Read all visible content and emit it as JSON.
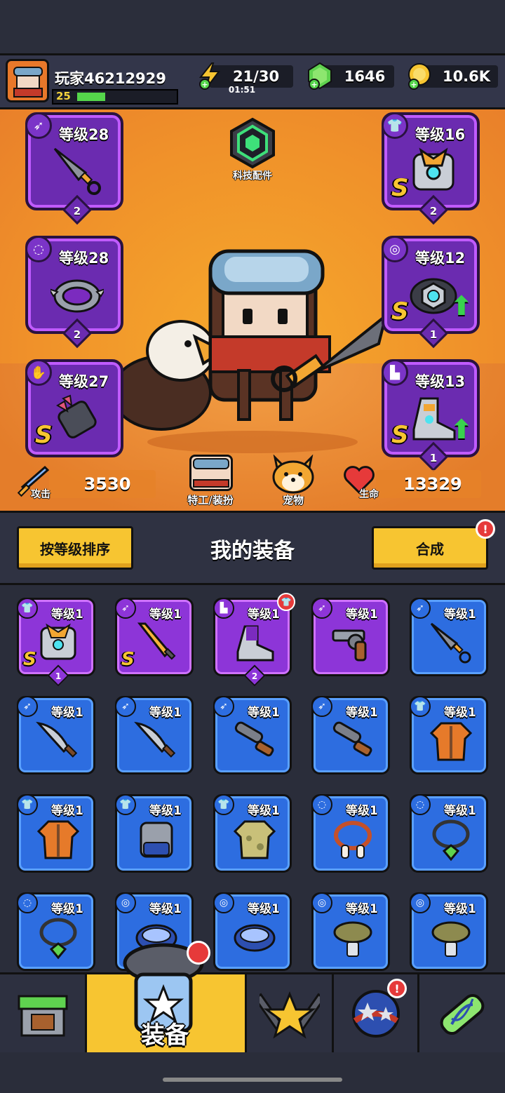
{
  "player": {
    "name": "玩家46212929",
    "level": "25"
  },
  "resources": {
    "energy": "21/30",
    "energy_timer": "01:51",
    "gems": "1646",
    "coins": "10.6K"
  },
  "hero_slots": [
    {
      "level": "等级28",
      "rank": "2",
      "s": ""
    },
    {
      "level": "等级16",
      "rank": "2",
      "s": "S"
    },
    {
      "level": "等级28",
      "rank": "2",
      "s": ""
    },
    {
      "level": "等级12",
      "rank": "1",
      "s": "S"
    },
    {
      "level": "等级27",
      "rank": "",
      "s": "S"
    },
    {
      "level": "等级13",
      "rank": "1",
      "s": "S"
    }
  ],
  "tech": {
    "label": "科技配件"
  },
  "stats": {
    "attack_label": "攻击",
    "attack": "3530",
    "hp_label": "生命",
    "hp": "13329",
    "agent_label": "特工/装扮",
    "pet_label": "宠物"
  },
  "equipment_header": {
    "sort_label": "按等级排序",
    "title": "我的装备",
    "merge_label": "合成",
    "merge_badge": "!"
  },
  "grid": [
    {
      "level": "等级1",
      "s": "S",
      "rank": "1"
    },
    {
      "level": "等级1",
      "s": "S",
      "rank": ""
    },
    {
      "level": "等级1",
      "s": "",
      "rank": "2"
    },
    {
      "level": "等级1",
      "s": "",
      "rank": ""
    },
    {
      "level": "等级1",
      "s": "",
      "rank": ""
    },
    {
      "level": "等级1"
    },
    {
      "level": "等级1"
    },
    {
      "level": "等级1"
    },
    {
      "level": "等级1"
    },
    {
      "level": "等级1"
    },
    {
      "level": "等级1"
    },
    {
      "level": "等级1"
    },
    {
      "level": "等级1"
    },
    {
      "level": "等级1"
    },
    {
      "level": "等级1"
    },
    {
      "level": "等级1"
    },
    {
      "level": "等级1"
    },
    {
      "level": "等级1"
    },
    {
      "level": "等级1"
    },
    {
      "level": "等级1"
    }
  ],
  "nav": {
    "equip_label": "装备",
    "event_badge": "!"
  },
  "colors": {
    "accent_yellow": "#f7c531",
    "rare_blue": "#2d6de0",
    "epic_purple": "#8d35d8",
    "hero_orange": "#f0922a"
  }
}
